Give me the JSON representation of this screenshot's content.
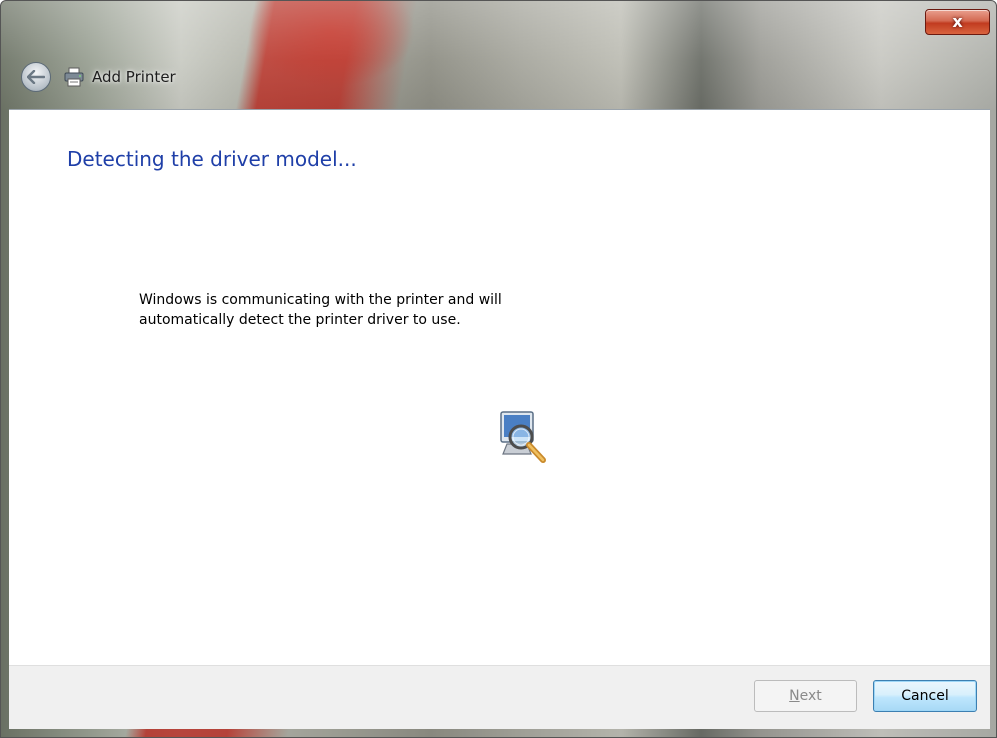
{
  "window": {
    "title": "Add Printer",
    "close_label": "x"
  },
  "icons": {
    "back": "back-arrow-icon",
    "printer": "printer-icon",
    "progress": "search-computer-icon"
  },
  "content": {
    "heading": "Detecting the driver model...",
    "message_line1": "Windows is communicating with the printer and will",
    "message_line2": "automatically detect the printer driver to use."
  },
  "footer": {
    "next_accel": "N",
    "next_rest": "ext",
    "cancel_label": "Cancel"
  },
  "colors": {
    "heading": "#1f3fa8",
    "close_button": "#c13b20",
    "cancel_border": "#3c7fb1"
  }
}
